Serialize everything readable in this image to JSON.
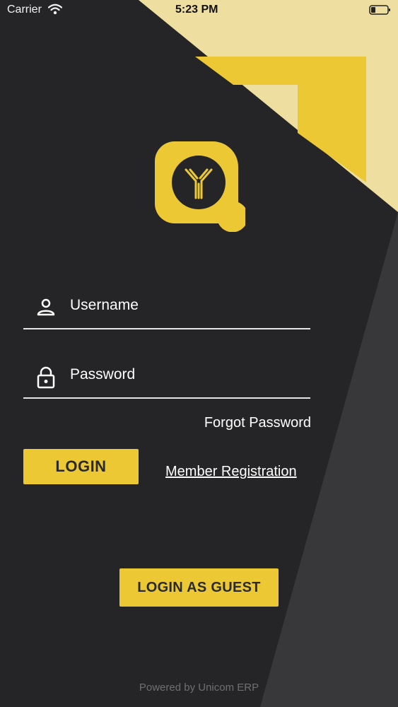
{
  "status_bar": {
    "carrier": "Carrier",
    "time": "5:23 PM",
    "wifi_icon": "wifi-icon",
    "battery_icon": "battery-low-icon"
  },
  "logo": {
    "icon": "app-logo-icon"
  },
  "form": {
    "username": {
      "placeholder": "Username",
      "value": "",
      "icon": "user-icon"
    },
    "password": {
      "placeholder": "Password",
      "value": "",
      "icon": "lock-icon"
    },
    "forgot_password": "Forgot Password",
    "login_label": "LOGIN",
    "member_registration": "Member Registration",
    "guest_label": "LOGIN AS GUEST"
  },
  "footer": {
    "powered_by": "Powered by Unicom ERP"
  },
  "colors": {
    "background": "#252527",
    "accent": "#ecc934",
    "accent_light": "#eedfa0",
    "panel_gray": "#38383b"
  }
}
